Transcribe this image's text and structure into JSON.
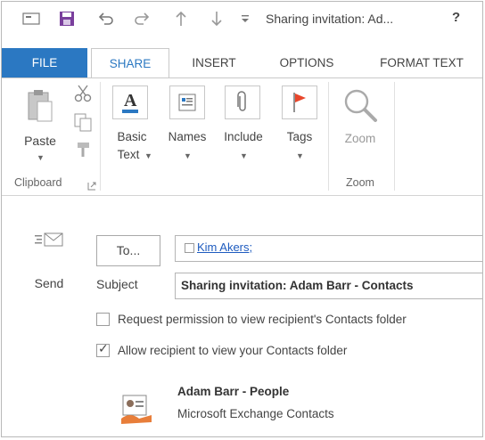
{
  "window": {
    "title": "Sharing invitation: Ad...",
    "help": "?"
  },
  "tabs": [
    "FILE",
    "SHARE",
    "INSERT",
    "OPTIONS",
    "FORMAT TEXT"
  ],
  "ribbon": {
    "clipboard": {
      "paste_label": "Paste",
      "group_label": "Clipboard"
    },
    "basic_text": {
      "line1": "Basic",
      "line2": "Text"
    },
    "names_label": "Names",
    "include_label": "Include",
    "tags_label": "Tags",
    "zoom": {
      "button_label": "Zoom",
      "group_label": "Zoom"
    }
  },
  "form": {
    "send_label": "Send",
    "to_button": "To...",
    "to_recipient": "Kim Akers;",
    "subject_label": "Subject",
    "subject_value": "Sharing invitation: Adam Barr - Contacts",
    "options": [
      {
        "label": "Request permission to view recipient's Contacts folder",
        "checked": false
      },
      {
        "label": "Allow recipient to view your Contacts folder",
        "checked": true
      }
    ],
    "shared_folder": {
      "name": "Adam Barr - People",
      "source": "Microsoft Exchange Contacts"
    }
  },
  "colors": {
    "file_tab": "#2b78c2",
    "active_tab_text": "#2b78c2",
    "link": "#1e5bbf",
    "save_icon": "#7a3f9d",
    "tags_flag": "#e8462b"
  }
}
